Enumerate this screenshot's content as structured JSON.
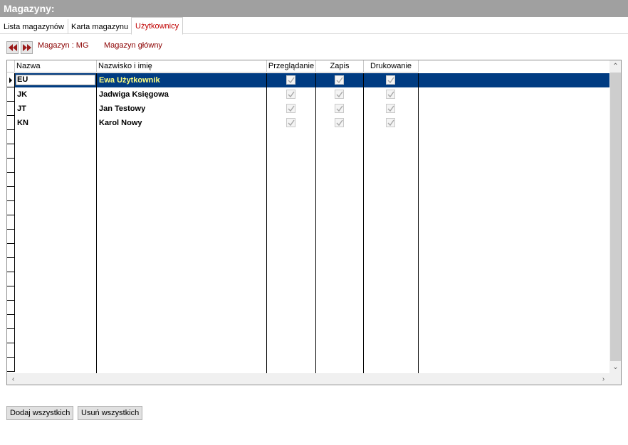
{
  "window": {
    "title": "Magazyny:"
  },
  "tabs": [
    {
      "label": "Lista magazynów",
      "active": false
    },
    {
      "label": "Karta magazynu",
      "active": false
    },
    {
      "label": "Użytkownicy",
      "active": true
    }
  ],
  "nav": {
    "first_icon": "rewind-icon",
    "last_icon": "fast-forward-icon"
  },
  "magazine": {
    "code_label": "Magazyn : MG",
    "name": "Magazyn główny"
  },
  "grid": {
    "columns": [
      "Nazwa",
      "Nazwisko i imię",
      "Przeglądanie",
      "Zapis",
      "Drukowanie"
    ],
    "rows": [
      {
        "code": "EU",
        "name": "Ewa Użytkownik",
        "view": true,
        "write": true,
        "print": true,
        "selected": true
      },
      {
        "code": "JK",
        "name": "Jadwiga Księgowa",
        "view": true,
        "write": true,
        "print": true,
        "selected": false
      },
      {
        "code": "JT",
        "name": "Jan Testowy",
        "view": true,
        "write": true,
        "print": true,
        "selected": false
      },
      {
        "code": "KN",
        "name": "Karol Nowy",
        "view": true,
        "write": true,
        "print": true,
        "selected": false
      }
    ]
  },
  "buttons": {
    "add_all": "Dodaj wszystkich",
    "remove_all": "Usuń wszystkich"
  },
  "colors": {
    "selection": "#003c82",
    "selection_text": "#ffff80",
    "accent": "#c00000",
    "info": "#8b0000"
  }
}
